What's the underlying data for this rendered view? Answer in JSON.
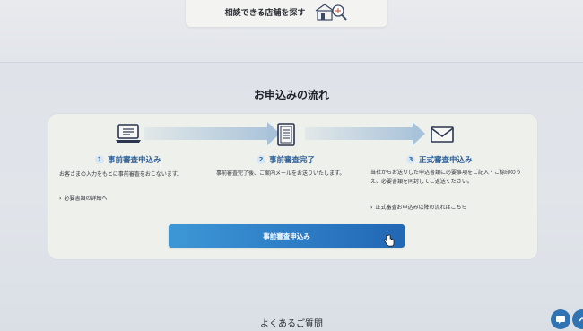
{
  "header": {
    "store_search_label": "相談できる店舗を探す",
    "store_icon": "store-search-icon"
  },
  "flow": {
    "title": "お申込みの流れ",
    "steps": [
      {
        "number": "1",
        "title": "事前審査申込み",
        "icon": "laptop-icon",
        "description": "お客さまの入力をもとに事前審査をおこないます。",
        "link": "必要書類の詳細へ"
      },
      {
        "number": "2",
        "title": "事前審査完了",
        "icon": "document-list-icon",
        "description": "事前審査完了後、ご案内メールをお送りいたします。",
        "link": ""
      },
      {
        "number": "3",
        "title": "正式審査申込み",
        "icon": "envelope-icon",
        "description": "当社からお送りした申込書類に必要事項をご記入・ご捺印のうえ、必要書類を同封してご返送ください。",
        "link": "正式審査お申込み以降の流れはこちら"
      }
    ],
    "apply_button_label": "事前審査申込み"
  },
  "faq": {
    "title": "よくあるご質問"
  },
  "colors": {
    "accent": "#2f7fc7",
    "step_title": "#2a5f98",
    "panel": "#eef0ec"
  }
}
